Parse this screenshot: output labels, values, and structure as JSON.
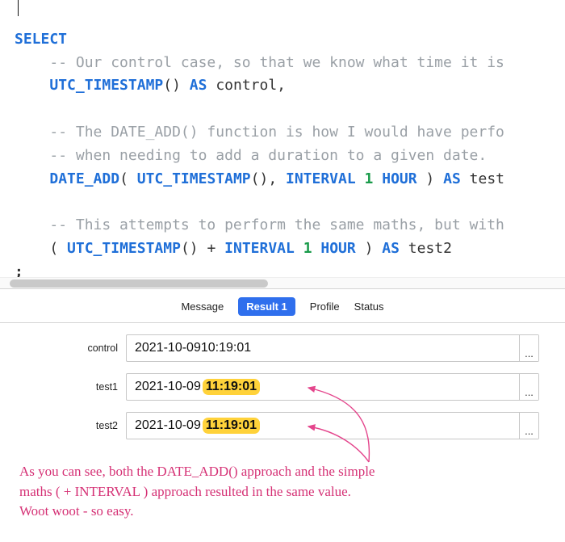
{
  "code": {
    "t_select": "SELECT",
    "c_control": "-- Our control case, so that we know what time it is",
    "fn_utc": "UTC_TIMESTAMP",
    "t_parens": "()",
    "t_as": "AS",
    "id_control": "control,",
    "c_dateadd1": "-- The DATE_ADD() function is how I would have perfo",
    "c_dateadd2": "-- when needing to add a duration to a given date.",
    "fn_dateadd": "DATE_ADD",
    "t_open": "( ",
    "t_mid": "(), ",
    "t_interval": "INTERVAL",
    "n_one": "1",
    "t_hour": "HOUR",
    "t_closeparen": " )",
    "id_test1": "test",
    "c_test2": "-- This attempts to perform the same maths, but with",
    "t_lparen": "( ",
    "t_plus": " + ",
    "t_rparen": " ) ",
    "id_test2": "test2",
    "t_semic": ";"
  },
  "tabs": {
    "message": "Message",
    "result1": "Result 1",
    "profile": "Profile",
    "status": "Status"
  },
  "rows": {
    "control": {
      "label": "control",
      "date": "2021-10-09 ",
      "time": "10:19:01"
    },
    "test1": {
      "label": "test1",
      "date": "2021-10-09 ",
      "time": "11:19:01"
    },
    "test2": {
      "label": "test2",
      "date": "2021-10-09 ",
      "time": "11:19:01"
    }
  },
  "ellipsis": "...",
  "annotation": {
    "l1": "As you can see, both the DATE_ADD() approach and the simple",
    "l2": "maths ( + INTERVAL ) approach resulted in the same value.",
    "l3": "Woot woot - so easy."
  },
  "colors": {
    "keyword": "#1f6fd8",
    "number": "#1a9b4a",
    "comment": "#9aa0a6",
    "tab_active_bg": "#2f6fed",
    "highlight_bg": "#ffd23a",
    "annotation": "#d53175"
  }
}
